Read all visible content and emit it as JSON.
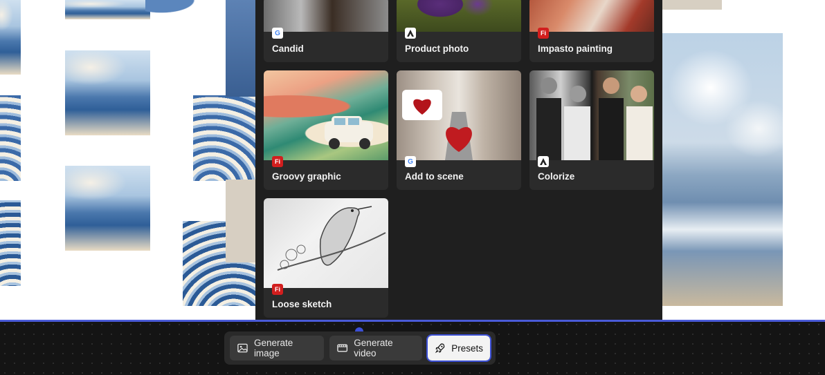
{
  "toolbar": {
    "generate_image": "Generate image",
    "generate_video": "Generate video",
    "presets": "Presets"
  },
  "presets": [
    {
      "label": "Candid",
      "provider": "google",
      "badge_text": "G"
    },
    {
      "label": "Product photo",
      "provider": "adobe",
      "badge_text": ""
    },
    {
      "label": "Impasto painting",
      "provider": "firefly",
      "badge_text": "Fi"
    },
    {
      "label": "Groovy graphic",
      "provider": "firefly",
      "badge_text": "Fi"
    },
    {
      "label": "Add to scene",
      "provider": "google",
      "badge_text": "G"
    },
    {
      "label": "Colorize",
      "provider": "adobe",
      "badge_text": ""
    },
    {
      "label": "Loose sketch",
      "provider": "firefly",
      "badge_text": "Fi"
    }
  ],
  "colors": {
    "accent": "#3b4fd6",
    "panel_bg": "#1f1f1f",
    "card_bg": "#2b2b2b",
    "firefly_badge": "#d21e1e"
  }
}
